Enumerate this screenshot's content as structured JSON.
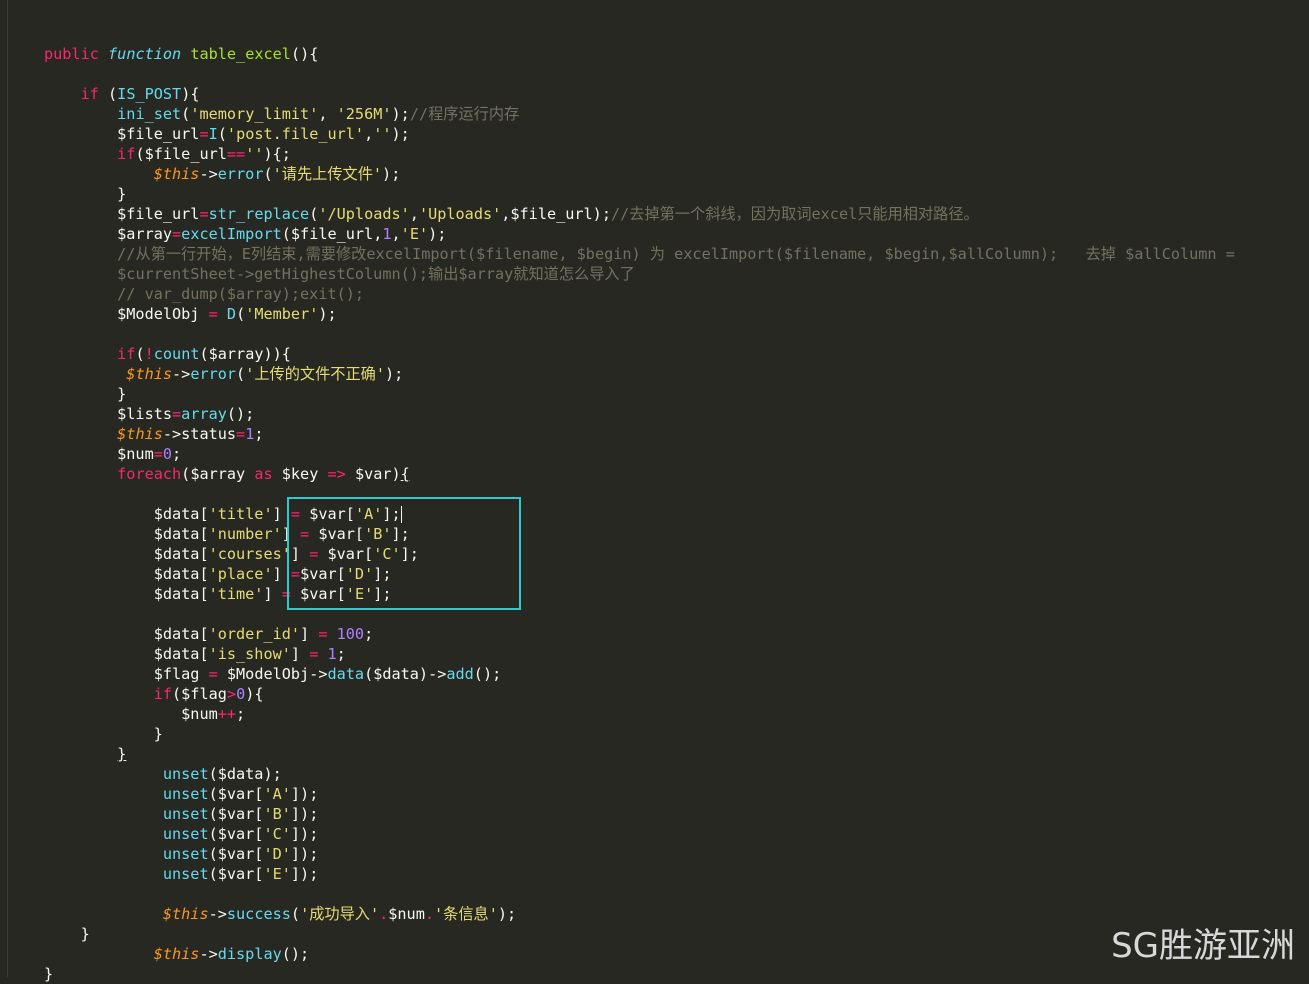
{
  "editor": {
    "lines": [
      {
        "i": 1,
        "t": "public function table_excel(){"
      },
      {
        "i": 3,
        "t": "if (IS_POST){"
      },
      {
        "i": 4,
        "t": "ini_set('memory_limit', '256M');//程序运行内存"
      },
      {
        "i": 5,
        "t": "$file_url=I('post.file_url','');"
      },
      {
        "i": 6,
        "t": "if($file_url==''){;"
      },
      {
        "i": 7,
        "t": "$this->error('请先上传文件');"
      },
      {
        "i": 8,
        "t": "}"
      },
      {
        "i": 9,
        "t": "$file_url=str_replace('/Uploads','Uploads',$file_url);//去掉第一个斜线，因为取词excel只能用相对路径。"
      },
      {
        "i": 10,
        "t": "$array=excelImport($file_url,1,'E');"
      },
      {
        "i": 11,
        "t": "//从第一行开始，E列结束,需要修改excelImport($filename, $begin) 为 excelImport($filename, $begin,$allColumn);   去掉 $allColumn ="
      },
      {
        "i": 12,
        "t": "$currentSheet->getHighestColumn();输出$array就知道怎么导入了"
      },
      {
        "i": 13,
        "t": "// var_dump($array);exit();"
      },
      {
        "i": 14,
        "t": "$ModelObj = D('Member');"
      },
      {
        "i": 16,
        "t": "if(!count($array)){"
      },
      {
        "i": 17,
        "t": "$this->error('上传的文件不正确');"
      },
      {
        "i": 18,
        "t": "}"
      },
      {
        "i": 19,
        "t": "$lists=array();"
      },
      {
        "i": 20,
        "t": "$this->status=1;"
      },
      {
        "i": 21,
        "t": "$num=0;"
      },
      {
        "i": 22,
        "t": "foreach($array as $key => $var){"
      },
      {
        "i": 24,
        "t": "$data['title'] = $var['A'];"
      },
      {
        "i": 25,
        "t": "$data['number'] = $var['B'];"
      },
      {
        "i": 26,
        "t": "$data['courses'] = $var['C'];"
      },
      {
        "i": 27,
        "t": "$data['place'] =$var['D'];"
      },
      {
        "i": 28,
        "t": "$data['time'] = $var['E'];"
      },
      {
        "i": 30,
        "t": "$data['order_id'] = 100;"
      },
      {
        "i": 31,
        "t": "$data['is_show'] = 1;"
      },
      {
        "i": 32,
        "t": "$flag = $ModelObj->data($data)->add();"
      },
      {
        "i": 33,
        "t": "if($flag>0){"
      },
      {
        "i": 34,
        "t": "$num++;"
      },
      {
        "i": 35,
        "t": "}"
      },
      {
        "i": 36,
        "t": "}"
      },
      {
        "i": 37,
        "t": "unset($data);"
      },
      {
        "i": 38,
        "t": "unset($var['A']);"
      },
      {
        "i": 39,
        "t": "unset($var['B']);"
      },
      {
        "i": 40,
        "t": "unset($var['C']);"
      },
      {
        "i": 41,
        "t": "unset($var['D']);"
      },
      {
        "i": 42,
        "t": "unset($var['E']);"
      },
      {
        "i": 44,
        "t": "$this->success('成功导入'.$num.'条信息');"
      },
      {
        "i": 45,
        "t": "}"
      },
      {
        "i": 46,
        "t": "$this->display();"
      },
      {
        "i": 47,
        "t": "}"
      }
    ]
  },
  "watermark": "SG胜游亚洲",
  "colors": {
    "background": "#272822",
    "keyword": "#f92672",
    "function": "#a6e22e",
    "string": "#e6db74",
    "number": "#ae81ff",
    "comment": "#75715e",
    "this": "#fd971f",
    "highlight_box": "#2fc9d0"
  }
}
